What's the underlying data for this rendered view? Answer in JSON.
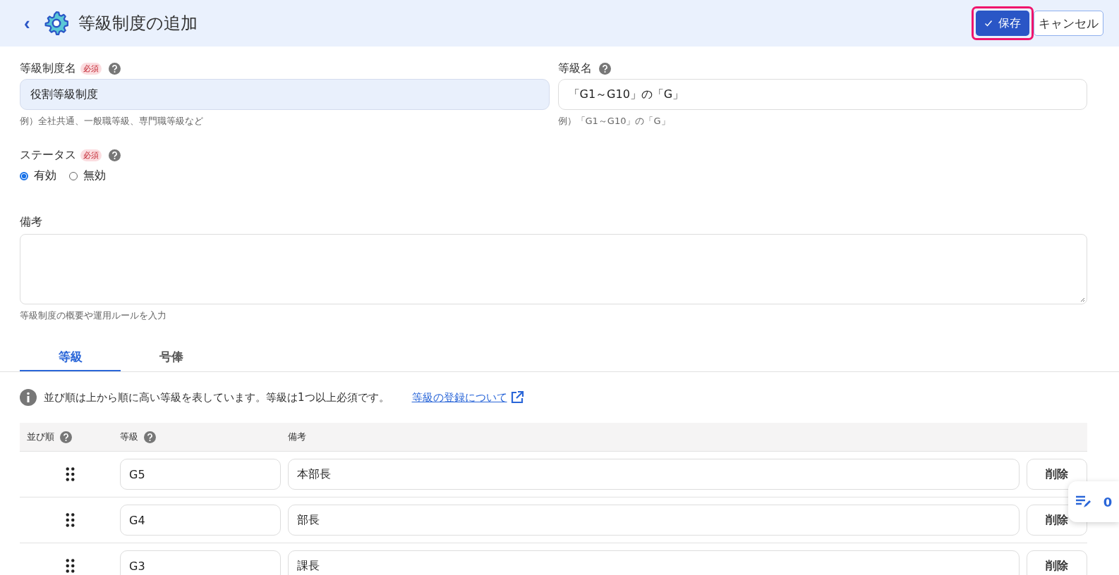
{
  "header": {
    "title": "等級制度の追加",
    "back": "‹",
    "save": "保存",
    "cancel": "キャンセル",
    "save_highlighted": true
  },
  "fields": [
    {
      "label": "等級制度名",
      "required_badge": "必須",
      "help": true,
      "value": "役割等級制度",
      "filled": true,
      "hint": "例）全社共通、一般職等級、専門職等級など"
    },
    {
      "label": "等級名",
      "help": true,
      "value": "「G1～G10」の「G」",
      "filled": false,
      "hint": "例）「G1～G10」の「G」"
    }
  ],
  "status": {
    "label": "ステータス",
    "required_badge": "必須",
    "help": true,
    "options": [
      {
        "label": "有効",
        "selected": true
      },
      {
        "label": "無効",
        "selected": false
      }
    ]
  },
  "remarks": {
    "label": "備考",
    "hint": "等級制度の概要や運用ルールを入力"
  },
  "tabs": [
    {
      "label": "等級",
      "selected": true
    },
    {
      "label": "号俸",
      "selected": false
    }
  ],
  "info": {
    "text": "並び順は上から順に高い等級を表しています。等級は1つ以上必須です。",
    "link": "等級の登録について"
  },
  "table": {
    "columns": [
      {
        "label": "並び順",
        "help": true
      },
      {
        "label": "等級",
        "help": true
      },
      {
        "label": "備考"
      }
    ],
    "rows": [
      {
        "grade": "G5",
        "remark": "本部長",
        "action": "削除"
      },
      {
        "grade": "G4",
        "remark": "部長",
        "action": "削除"
      },
      {
        "grade": "G3",
        "remark": "課長",
        "action": "削除"
      }
    ]
  },
  "floating": {
    "count": "0"
  }
}
